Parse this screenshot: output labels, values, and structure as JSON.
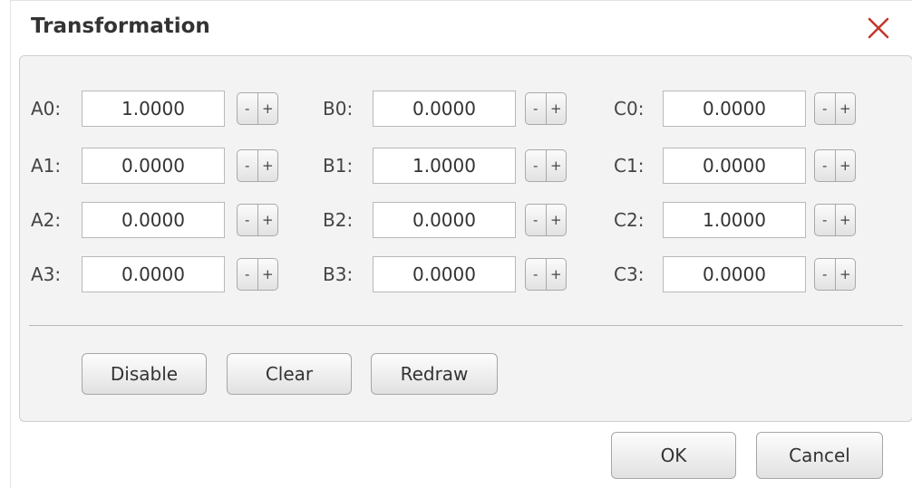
{
  "dialog": {
    "title": "Transformation",
    "close_icon": "close-icon",
    "accent_color": "#c0392b"
  },
  "fields": {
    "A0": {
      "label": "A0:",
      "value": "1.0000"
    },
    "A1": {
      "label": "A1:",
      "value": "0.0000"
    },
    "A2": {
      "label": "A2:",
      "value": "0.0000"
    },
    "A3": {
      "label": "A3:",
      "value": "0.0000"
    },
    "B0": {
      "label": "B0:",
      "value": "0.0000"
    },
    "B1": {
      "label": "B1:",
      "value": "1.0000"
    },
    "B2": {
      "label": "B2:",
      "value": "0.0000"
    },
    "B3": {
      "label": "B3:",
      "value": "0.0000"
    },
    "C0": {
      "label": "C0:",
      "value": "0.0000"
    },
    "C1": {
      "label": "C1:",
      "value": "0.0000"
    },
    "C2": {
      "label": "C2:",
      "value": "1.0000"
    },
    "C3": {
      "label": "C3:",
      "value": "0.0000"
    }
  },
  "stepper": {
    "minus": "-",
    "plus": "+"
  },
  "actions": {
    "disable": "Disable",
    "clear": "Clear",
    "redraw": "Redraw"
  },
  "footer": {
    "ok": "OK",
    "cancel": "Cancel"
  }
}
